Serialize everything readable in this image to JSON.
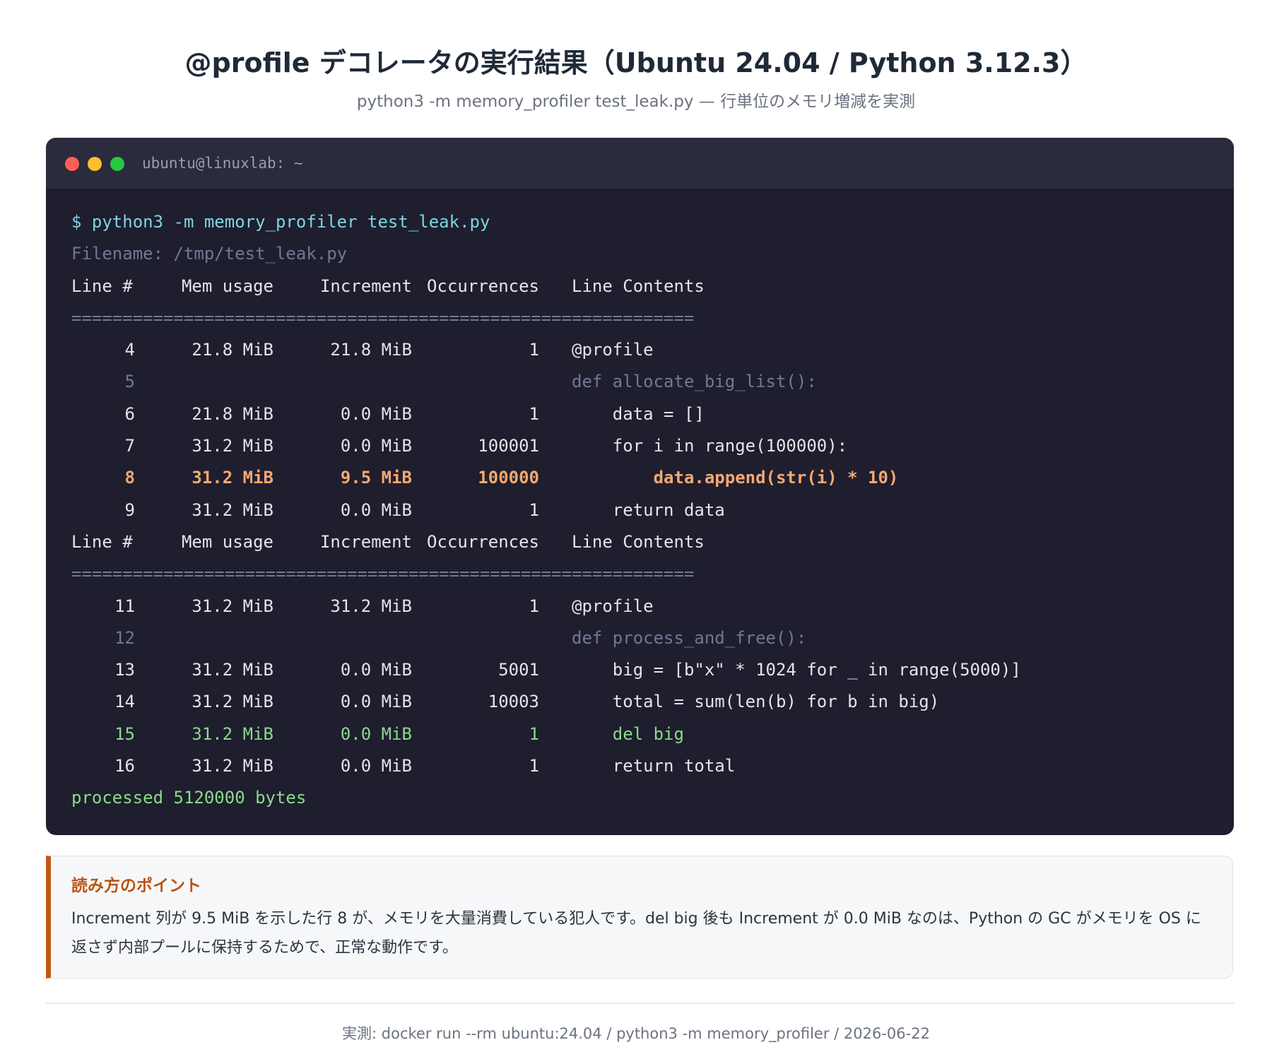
{
  "title": "@profile デコレータの実行結果（Ubuntu 24.04 / Python 3.12.3）",
  "subtitle": "python3 -m memory_profiler test_leak.py — 行単位のメモリ増減を実測",
  "terminal": {
    "window_title": "ubuntu@linuxlab: ~",
    "command": "$ python3 -m memory_profiler test_leak.py",
    "filename": "Filename: /tmp/test_leak.py",
    "header": {
      "line": "Line #",
      "mem": "Mem usage",
      "inc": "Increment",
      "occ": "Occurrences",
      "code": "Line Contents"
    },
    "separator": "=============================================================",
    "blocks": [
      {
        "rows": [
          {
            "line": "4",
            "mem": "21.8 MiB",
            "inc": "21.8 MiB",
            "occ": "1",
            "code": "@profile",
            "style": "normal"
          },
          {
            "line": "5",
            "mem": "",
            "inc": "",
            "occ": "",
            "code": "def allocate_big_list():",
            "style": "dim"
          },
          {
            "line": "6",
            "mem": "21.8 MiB",
            "inc": "0.0 MiB",
            "occ": "1",
            "code": "    data = []",
            "style": "normal"
          },
          {
            "line": "7",
            "mem": "31.2 MiB",
            "inc": "0.0 MiB",
            "occ": "100001",
            "code": "    for i in range(100000):",
            "style": "normal"
          },
          {
            "line": "8",
            "mem": "31.2 MiB",
            "inc": "9.5 MiB",
            "occ": "100000",
            "code": "        data.append(str(i) * 10)",
            "style": "orange"
          },
          {
            "line": "9",
            "mem": "31.2 MiB",
            "inc": "0.0 MiB",
            "occ": "1",
            "code": "    return data",
            "style": "normal"
          }
        ]
      },
      {
        "rows": [
          {
            "line": "11",
            "mem": "31.2 MiB",
            "inc": "31.2 MiB",
            "occ": "1",
            "code": "@profile",
            "style": "normal"
          },
          {
            "line": "12",
            "mem": "",
            "inc": "",
            "occ": "",
            "code": "def process_and_free():",
            "style": "dim"
          },
          {
            "line": "13",
            "mem": "31.2 MiB",
            "inc": "0.0 MiB",
            "occ": "5001",
            "code": "    big = [b\"x\" * 1024 for _ in range(5000)]",
            "style": "normal"
          },
          {
            "line": "14",
            "mem": "31.2 MiB",
            "inc": "0.0 MiB",
            "occ": "10003",
            "code": "    total = sum(len(b) for b in big)",
            "style": "normal"
          },
          {
            "line": "15",
            "mem": "31.2 MiB",
            "inc": "0.0 MiB",
            "occ": "1",
            "code": "    del big",
            "style": "green"
          },
          {
            "line": "16",
            "mem": "31.2 MiB",
            "inc": "0.0 MiB",
            "occ": "1",
            "code": "    return total",
            "style": "normal"
          }
        ]
      }
    ],
    "output": "processed 5120000 bytes"
  },
  "note": {
    "heading": "読み方のポイント",
    "text": "Increment 列が 9.5 MiB を示した行 8 が、メモリを大量消費している犯人です。del big 後も Increment が 0.0 MiB なのは、Python の GC がメモリを OS に返さず内部プールに保持するためで、正常な動作です。"
  },
  "footer": "実測: docker run --rm ubuntu:24.04 / python3 -m memory_profiler / 2026-06-22",
  "colors": {
    "terminal_bg": "#1e1e2e",
    "terminal_header_bg": "#2a2b3d",
    "command": "#7fd4e3",
    "highlight_orange": "#f5a86f",
    "highlight_green": "#8dd98c",
    "accent": "#c05a16"
  }
}
